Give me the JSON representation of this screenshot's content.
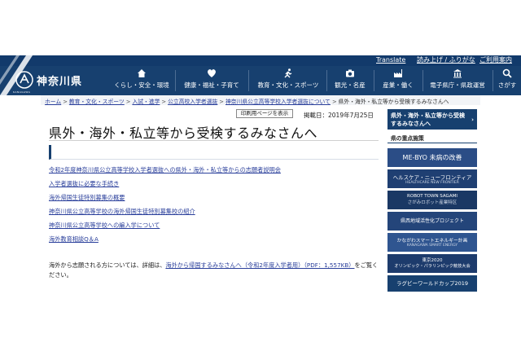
{
  "header": {
    "logo_text": "神奈川県",
    "logo_sub": "KANAGAWA",
    "util_links": [
      "Translate",
      "読み上げ / ふりがな",
      "ご利用案内"
    ]
  },
  "nav": {
    "items": [
      {
        "label": "くらし・安全・環境",
        "icon": "home-icon"
      },
      {
        "label": "健康・福祉・子育て",
        "icon": "heart-cross-icon"
      },
      {
        "label": "教育・文化・スポーツ",
        "icon": "runner-icon"
      },
      {
        "label": "観光・名産",
        "icon": "camera-icon"
      },
      {
        "label": "産業・働く",
        "icon": "factory-icon"
      },
      {
        "label": "電子県庁・県政運営",
        "icon": "building-icon"
      },
      {
        "label": "さがす",
        "icon": "search-icon"
      }
    ]
  },
  "breadcrumb": {
    "items": [
      "ホーム",
      "教育・文化・スポーツ",
      "入試・進学",
      "公立高校入学者選抜",
      "神奈川県公立高等学校入学者選抜について"
    ],
    "current": "県外・海外・私立等から受検するみなさんへ",
    "separator": ">"
  },
  "page": {
    "print_label": "印刷用ページを表示",
    "published": "掲載日：2019年7月25日",
    "title": "県外・海外・私立等から受検するみなさんへ",
    "links": [
      "令和2年度神奈川県公立高等学校入学者選抜への県外・海外・私立等からの志願者説明会",
      "入学者選抜に必要な手続き",
      "海外帰国生徒特別募集の概要",
      "神奈川県公立高等学校の海外帰国生徒特別募集校の紹介",
      "神奈川県公立高等学校への編入学について",
      "海外教育相談Q＆A"
    ],
    "body_prefix": "海外から志願される方については、詳細は、",
    "body_link": "海外から帰国するみなさんへ（令和2年度入学者用）（PDF：1,557KB）",
    "body_suffix": "をご覧ください。"
  },
  "sidebar": {
    "header": "県外・海外・私立等から受検するみなさんへ",
    "header_arrow": "›",
    "section_label": "県の重点施策",
    "banners": [
      {
        "main": "ME-BYO 未病の改善",
        "sub": ""
      },
      {
        "main": "ヘルスケア・ニューフロンティア",
        "sub": "HEALTHCARE NEW FRONTIER"
      },
      {
        "main": "ROBOT TOWN SAGAMI",
        "sub": "さがみロボット産業特区"
      },
      {
        "main": "県西地域活性化プロジェクト",
        "sub": ""
      },
      {
        "main": "かながわスマートエネルギー計画",
        "sub": "KANAGAWA SMART ENERGY"
      },
      {
        "main": "東京2020",
        "sub": "オリンピック・パラリンピック競技大会"
      },
      {
        "main": "ラグビーワールドカップ2019",
        "sub": ""
      }
    ]
  },
  "colors": {
    "navy": "#17406f",
    "link": "#2a3f9b"
  }
}
